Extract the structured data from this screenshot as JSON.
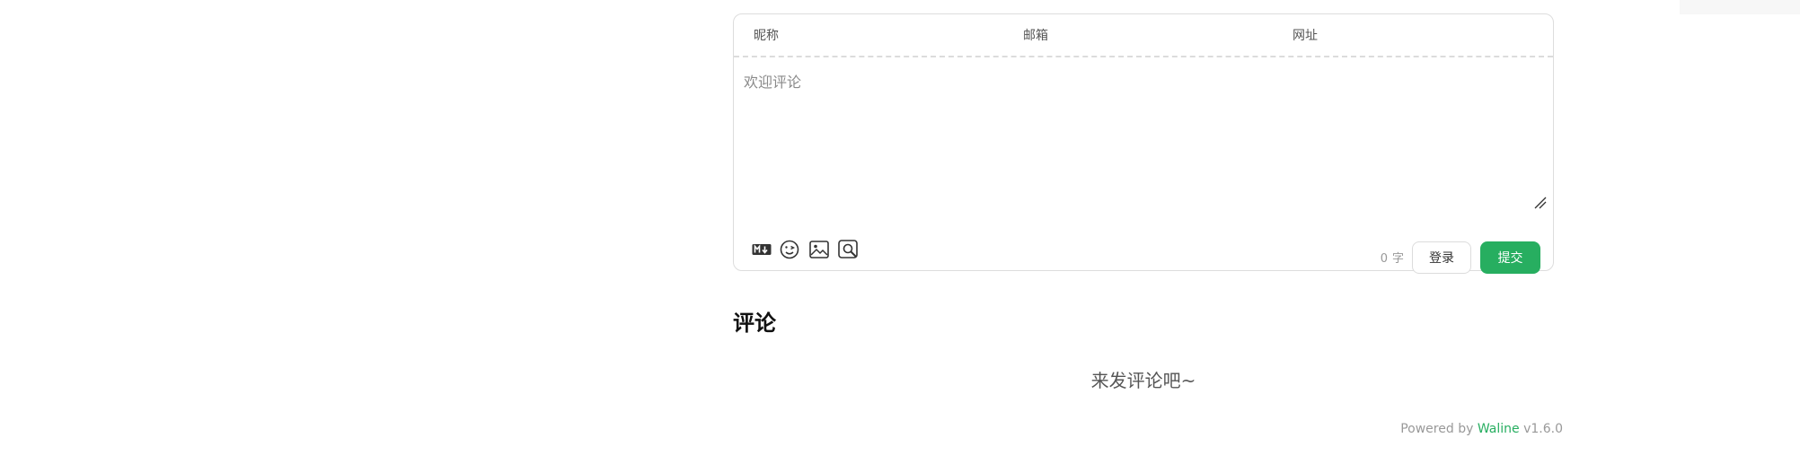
{
  "form": {
    "nick_label": "昵称",
    "mail_label": "邮箱",
    "link_label": "网址",
    "nick_value": "",
    "mail_value": "",
    "link_value": "",
    "comment_placeholder": "欢迎评论",
    "comment_value": ""
  },
  "toolbar": {
    "icons": [
      "markdown-icon",
      "emoji-icon",
      "image-icon",
      "preview-icon"
    ],
    "word_count": "0",
    "word_unit": "字",
    "login_label": "登录",
    "submit_label": "提交"
  },
  "comments": {
    "title": "评论",
    "empty_text": "来发评论吧~"
  },
  "footer": {
    "powered_prefix": "Powered by",
    "brand": "Waline",
    "version": "v1.6.0"
  },
  "colors": {
    "accent": "#27ae60",
    "border": "#dddddd",
    "muted": "#999999"
  }
}
